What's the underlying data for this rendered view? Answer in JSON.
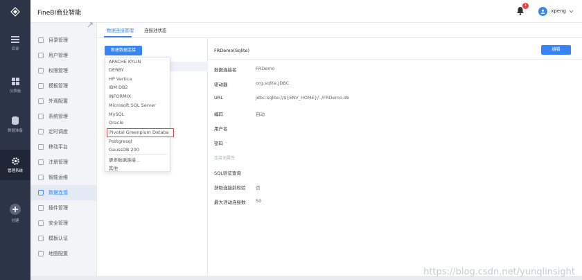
{
  "app": {
    "title": "FineBI商业智能"
  },
  "user": {
    "name": "xpeng",
    "notifications": "1"
  },
  "leftnav": [
    {
      "label": "目录"
    },
    {
      "label": "仪表板"
    },
    {
      "label": "数据准备"
    },
    {
      "label": "管理系统"
    },
    {
      "label": "创建"
    }
  ],
  "submenu": [
    {
      "label": "目录管理",
      "icon": "folder-icon"
    },
    {
      "label": "用户管理",
      "icon": "user-icon"
    },
    {
      "label": "权限管理",
      "icon": "permission-icon"
    },
    {
      "label": "模板管理",
      "icon": "template-icon"
    },
    {
      "label": "外观配置",
      "icon": "appearance-icon"
    },
    {
      "label": "系统管理",
      "icon": "system-icon"
    },
    {
      "label": "定时调度",
      "icon": "clock-icon"
    },
    {
      "label": "移动平台",
      "icon": "mobile-icon"
    },
    {
      "label": "注册管理",
      "icon": "register-icon"
    },
    {
      "label": "智能运维",
      "icon": "ops-icon"
    },
    {
      "label": "数据连接",
      "icon": "data-connection-icon"
    },
    {
      "label": "插件管理",
      "icon": "plugin-icon"
    },
    {
      "label": "安全管理",
      "icon": "security-icon"
    },
    {
      "label": "模板认证",
      "icon": "certification-icon"
    },
    {
      "label": "地图配置",
      "icon": "map-icon"
    }
  ],
  "tabs": [
    {
      "label": "数据连接管理"
    },
    {
      "label": "连接池状态"
    }
  ],
  "new_connection_button": "新建数据连接",
  "dropdown": {
    "items": [
      "APACHE KYLIN",
      "DERBY",
      "HP Vertica",
      "IBM DB2",
      "INFORMIX",
      "Microsoft SQL Server",
      "MySQL",
      "Oracle",
      "Pivotal Greenplum Databa",
      "Postgresql",
      "GaussDB 200",
      "更多数据连接...",
      "其他"
    ],
    "highlighted_index": 8
  },
  "detail": {
    "title": "FRDemo(Sqlite)",
    "edit_button": "编辑",
    "fields": [
      {
        "label": "数据连接名",
        "value": "FRDemo"
      },
      {
        "label": "驱动器",
        "value": "org.sqlite.JDBC"
      },
      {
        "label": "URL",
        "value": "jdbc:sqlite://${ENV_HOME}/../FRDemo.db"
      },
      {
        "label": "编码",
        "value": "自动"
      },
      {
        "label": "用户名",
        "value": ""
      },
      {
        "label": "密码",
        "value": ""
      }
    ],
    "section": "连接池属性",
    "pool_fields": [
      {
        "label": "SQL验证查询",
        "value": ""
      },
      {
        "label": "获取连接前校验",
        "value": "否"
      },
      {
        "label": "最大活动连接数",
        "value": "50"
      }
    ]
  },
  "watermark": "https://blog.csdn.net/yunqlinsight",
  "colors": {
    "accent": "#3685f2",
    "nav_bg": "#2c3447",
    "highlight_border": "#d94848"
  }
}
